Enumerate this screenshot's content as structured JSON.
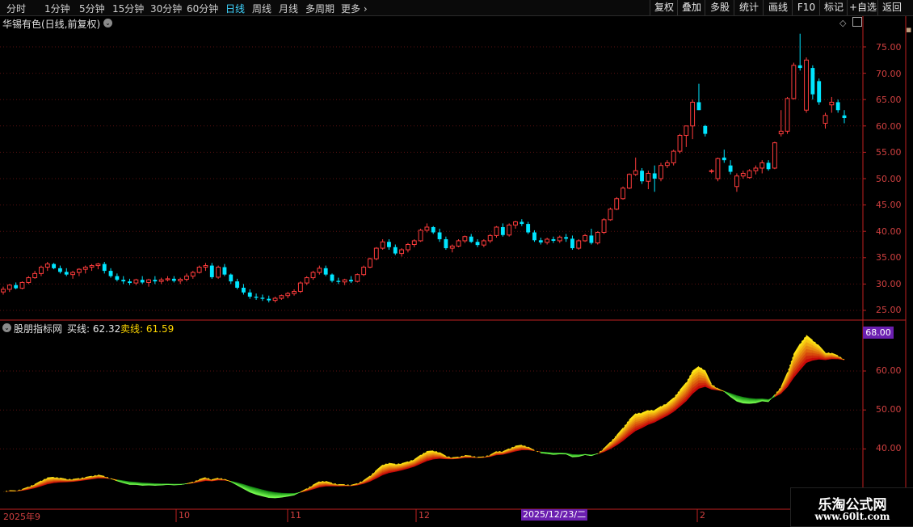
{
  "toolbar": {
    "periods": [
      "分时",
      "1分钟",
      "5分钟",
      "15分钟",
      "30分钟",
      "60分钟",
      "日线",
      "周线",
      "月线",
      "多周期",
      "更多"
    ],
    "active_period": "日线",
    "tools": [
      "复权",
      "叠加",
      "多股",
      "统计",
      "画线",
      "F10",
      "标记",
      "+自选",
      "返回"
    ]
  },
  "main_panel": {
    "title": "华锡有色(日线,前复权)",
    "y_ticks": [
      "75.00",
      "70.00",
      "65.00",
      "60.00",
      "55.00",
      "50.00",
      "45.00",
      "40.00",
      "35.00",
      "30.00",
      "25.00"
    ]
  },
  "indicator_panel": {
    "name": "股朋指标网",
    "buy_label": "买线: 62.32",
    "sell_label": "卖线: 61.59",
    "badge": "68.00",
    "y_ticks": [
      "60.00",
      "50.00",
      "40.00"
    ]
  },
  "x_axis": {
    "labels": [
      "2025年9",
      "10",
      "11",
      "12",
      "2",
      "2025/12/23/二"
    ]
  },
  "watermark": {
    "title": "乐淘公式网",
    "url": "www.60lt.com"
  },
  "colors": {
    "up": "#ff3c3c",
    "down": "#00e5ff",
    "axis": "#c02020",
    "grid": "#5a1010",
    "buy_line": "#e0e0e0",
    "sell_line": "#ffd700",
    "badge": "#6b1fb0"
  },
  "chart_data": {
    "type": "candlestick",
    "title": "华锡有色(日线,前复权)",
    "ylim": [
      23,
      78
    ],
    "candles": [
      [
        28.5,
        29.5,
        28.0,
        29.0
      ],
      [
        29.0,
        30.0,
        28.5,
        29.8
      ],
      [
        29.8,
        30.3,
        29.0,
        29.2
      ],
      [
        29.2,
        30.5,
        29.0,
        30.3
      ],
      [
        30.3,
        31.5,
        30.0,
        31.2
      ],
      [
        31.2,
        32.5,
        31.0,
        32.0
      ],
      [
        32.0,
        33.5,
        31.5,
        33.2
      ],
      [
        33.2,
        34.2,
        32.5,
        33.8
      ],
      [
        33.8,
        34.0,
        32.8,
        33.0
      ],
      [
        33.0,
        33.5,
        32.0,
        32.3
      ],
      [
        32.3,
        33.0,
        31.5,
        31.8
      ],
      [
        31.8,
        32.5,
        31.0,
        32.2
      ],
      [
        32.2,
        33.0,
        31.5,
        32.8
      ],
      [
        32.8,
        33.5,
        32.0,
        33.2
      ],
      [
        33.2,
        33.8,
        32.5,
        33.5
      ],
      [
        33.5,
        34.0,
        32.8,
        33.8
      ],
      [
        33.8,
        34.2,
        32.0,
        32.5
      ],
      [
        32.5,
        33.0,
        31.2,
        31.5
      ],
      [
        31.5,
        32.0,
        30.5,
        30.8
      ],
      [
        30.8,
        31.5,
        30.0,
        30.5
      ],
      [
        30.5,
        31.0,
        29.8,
        30.2
      ],
      [
        30.2,
        31.0,
        29.8,
        30.8
      ],
      [
        30.8,
        31.5,
        30.0,
        30.3
      ],
      [
        30.3,
        31.0,
        29.5,
        30.8
      ],
      [
        30.8,
        31.5,
        30.0,
        30.5
      ],
      [
        30.5,
        31.2,
        30.0,
        30.8
      ],
      [
        30.8,
        31.5,
        30.5,
        31.0
      ],
      [
        31.0,
        31.5,
        30.3,
        30.6
      ],
      [
        30.6,
        31.2,
        30.0,
        30.9
      ],
      [
        30.9,
        32.0,
        30.5,
        31.5
      ],
      [
        31.5,
        32.5,
        31.0,
        32.2
      ],
      [
        32.2,
        33.5,
        32.0,
        33.2
      ],
      [
        33.2,
        34.0,
        32.5,
        33.5
      ],
      [
        33.5,
        34.0,
        31.0,
        31.3
      ],
      [
        31.3,
        33.5,
        31.0,
        33.2
      ],
      [
        33.2,
        33.8,
        31.5,
        31.8
      ],
      [
        31.8,
        32.0,
        30.0,
        30.5
      ],
      [
        30.5,
        31.0,
        29.0,
        29.3
      ],
      [
        29.3,
        30.0,
        28.0,
        28.4
      ],
      [
        28.4,
        29.0,
        27.2,
        27.6
      ],
      [
        27.6,
        28.2,
        27.0,
        27.4
      ],
      [
        27.4,
        28.0,
        26.8,
        27.2
      ],
      [
        27.2,
        27.8,
        26.5,
        26.9
      ],
      [
        26.9,
        27.6,
        26.5,
        27.3
      ],
      [
        27.3,
        28.0,
        27.0,
        27.8
      ],
      [
        27.8,
        28.5,
        27.3,
        28.2
      ],
      [
        28.2,
        29.0,
        27.8,
        28.6
      ],
      [
        28.6,
        30.5,
        28.3,
        30.2
      ],
      [
        30.2,
        31.5,
        29.8,
        31.2
      ],
      [
        31.2,
        32.5,
        30.8,
        32.2
      ],
      [
        32.2,
        33.5,
        31.8,
        33.0
      ],
      [
        33.0,
        33.5,
        31.5,
        31.8
      ],
      [
        31.8,
        32.0,
        30.3,
        30.6
      ],
      [
        30.6,
        31.2,
        30.0,
        30.4
      ],
      [
        30.4,
        31.0,
        29.8,
        30.8
      ],
      [
        30.8,
        31.5,
        30.2,
        30.5
      ],
      [
        30.5,
        32.0,
        30.3,
        31.8
      ],
      [
        31.8,
        33.5,
        31.5,
        33.2
      ],
      [
        33.2,
        35.0,
        33.0,
        34.8
      ],
      [
        34.8,
        37.0,
        34.5,
        36.8
      ],
      [
        36.8,
        38.5,
        36.5,
        38.0
      ],
      [
        38.0,
        38.5,
        36.5,
        37.0
      ],
      [
        37.0,
        37.5,
        35.5,
        35.8
      ],
      [
        35.8,
        36.8,
        35.2,
        36.5
      ],
      [
        36.5,
        37.8,
        36.0,
        37.5
      ],
      [
        37.5,
        38.5,
        37.0,
        38.2
      ],
      [
        38.2,
        40.5,
        38.0,
        40.2
      ],
      [
        40.2,
        41.5,
        39.8,
        40.8
      ],
      [
        40.8,
        41.0,
        39.5,
        39.8
      ],
      [
        39.8,
        40.5,
        38.0,
        38.5
      ],
      [
        38.5,
        39.0,
        36.5,
        36.8
      ],
      [
        36.8,
        37.5,
        36.0,
        37.2
      ],
      [
        37.2,
        38.5,
        37.0,
        38.2
      ],
      [
        38.2,
        39.2,
        37.8,
        39.0
      ],
      [
        39.0,
        39.5,
        37.8,
        38.0
      ],
      [
        38.0,
        38.5,
        37.0,
        37.4
      ],
      [
        37.4,
        38.5,
        37.0,
        38.2
      ],
      [
        38.2,
        39.5,
        37.8,
        39.2
      ],
      [
        39.2,
        41.0,
        38.8,
        40.8
      ],
      [
        40.8,
        41.5,
        39.0,
        39.3
      ],
      [
        39.3,
        41.5,
        39.0,
        41.2
      ],
      [
        41.2,
        42.0,
        40.5,
        41.8
      ],
      [
        41.8,
        42.3,
        41.0,
        41.4
      ],
      [
        41.4,
        41.8,
        39.5,
        39.8
      ],
      [
        39.8,
        40.2,
        38.0,
        38.3
      ],
      [
        38.3,
        38.8,
        37.5,
        37.9
      ],
      [
        37.9,
        38.8,
        37.5,
        38.5
      ],
      [
        38.5,
        39.0,
        37.8,
        38.2
      ],
      [
        38.2,
        39.2,
        37.8,
        38.9
      ],
      [
        38.9,
        39.5,
        38.0,
        38.6
      ],
      [
        38.6,
        39.2,
        36.5,
        36.8
      ],
      [
        36.8,
        38.5,
        36.5,
        38.2
      ],
      [
        38.2,
        39.5,
        38.0,
        39.2
      ],
      [
        39.2,
        40.5,
        37.5,
        37.8
      ],
      [
        37.8,
        40.0,
        37.5,
        39.8
      ],
      [
        39.8,
        42.5,
        39.5,
        42.2
      ],
      [
        42.2,
        44.5,
        42.0,
        44.2
      ],
      [
        44.2,
        46.5,
        44.0,
        46.2
      ],
      [
        46.2,
        48.5,
        46.0,
        48.2
      ],
      [
        48.2,
        51.0,
        48.0,
        50.8
      ],
      [
        50.8,
        54.0,
        50.5,
        51.5
      ],
      [
        51.5,
        52.0,
        49.0,
        49.5
      ],
      [
        49.5,
        51.5,
        48.0,
        51.0
      ],
      [
        51.0,
        52.5,
        47.5,
        50.0
      ],
      [
        50.0,
        53.0,
        49.5,
        52.5
      ],
      [
        52.5,
        53.5,
        52.0,
        53.0
      ],
      [
        53.0,
        55.5,
        52.5,
        55.2
      ],
      [
        55.2,
        58.5,
        54.8,
        58.2
      ],
      [
        58.2,
        59.5,
        56.0,
        60.0
      ],
      [
        60.0,
        65.0,
        57.5,
        64.5
      ],
      [
        64.5,
        68.0,
        63.0,
        63.0
      ],
      [
        60.0,
        60.2,
        58.0,
        58.5
      ],
      [
        51.5,
        51.8,
        51.0,
        51.5
      ],
      [
        50.0,
        54.0,
        49.5,
        53.8
      ],
      [
        54.0,
        55.5,
        53.0,
        53.5
      ],
      [
        52.5,
        53.5,
        50.8,
        51.3
      ],
      [
        48.5,
        51.0,
        47.5,
        50.5
      ],
      [
        50.5,
        51.5,
        50.0,
        51.0
      ],
      [
        50.2,
        51.8,
        50.0,
        51.5
      ],
      [
        51.5,
        52.5,
        50.8,
        52.0
      ],
      [
        52.0,
        53.5,
        51.0,
        53.0
      ],
      [
        53.0,
        53.5,
        51.5,
        51.8
      ],
      [
        52.0,
        57.0,
        51.8,
        56.8
      ],
      [
        58.5,
        63.0,
        58.0,
        59.0
      ],
      [
        59.0,
        65.5,
        58.5,
        65.2
      ],
      [
        65.2,
        72.0,
        65.0,
        71.5
      ],
      [
        71.5,
        77.5,
        70.5,
        71.0
      ],
      [
        63.0,
        73.0,
        62.5,
        72.5
      ],
      [
        71.0,
        71.5,
        65.0,
        66.0
      ],
      [
        68.5,
        69.0,
        64.0,
        64.5
      ],
      [
        60.5,
        62.5,
        59.5,
        62.0
      ],
      [
        64.0,
        65.5,
        62.5,
        64.5
      ],
      [
        64.5,
        65.0,
        62.5,
        63.0
      ],
      [
        62.0,
        63.0,
        60.5,
        61.5
      ]
    ],
    "buy_line": "62.32",
    "sell_line": "61.59"
  }
}
